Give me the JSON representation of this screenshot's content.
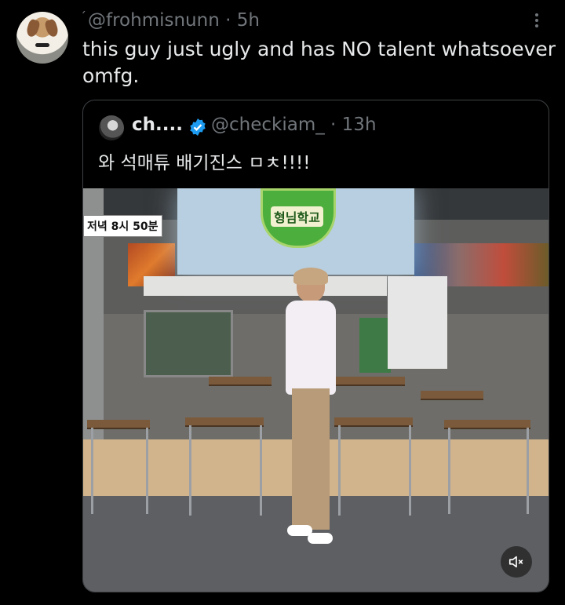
{
  "tweet": {
    "tick": "ˊ",
    "handle": "@frohmisnunn",
    "separator": " · ",
    "time": "5h",
    "text_line1": "this guy just ugly and has NO talent whatsoever",
    "text_line2": "omfg."
  },
  "quoted": {
    "name": "ch....",
    "handle": "@checkiam_",
    "separator": " · ",
    "time": "13h",
    "text": "와 석매튜 배기진스 ㅁㅊ!!!!",
    "verified_color": "#1d9bf0"
  },
  "video": {
    "broadcast_time": "저녁 8시 50분",
    "logo_text": "형님학교",
    "mute_icon": "volume-muted-icon"
  },
  "colors": {
    "background": "#000000",
    "text": "#e7e9ea",
    "muted": "#71767b",
    "border": "#3e4144"
  }
}
